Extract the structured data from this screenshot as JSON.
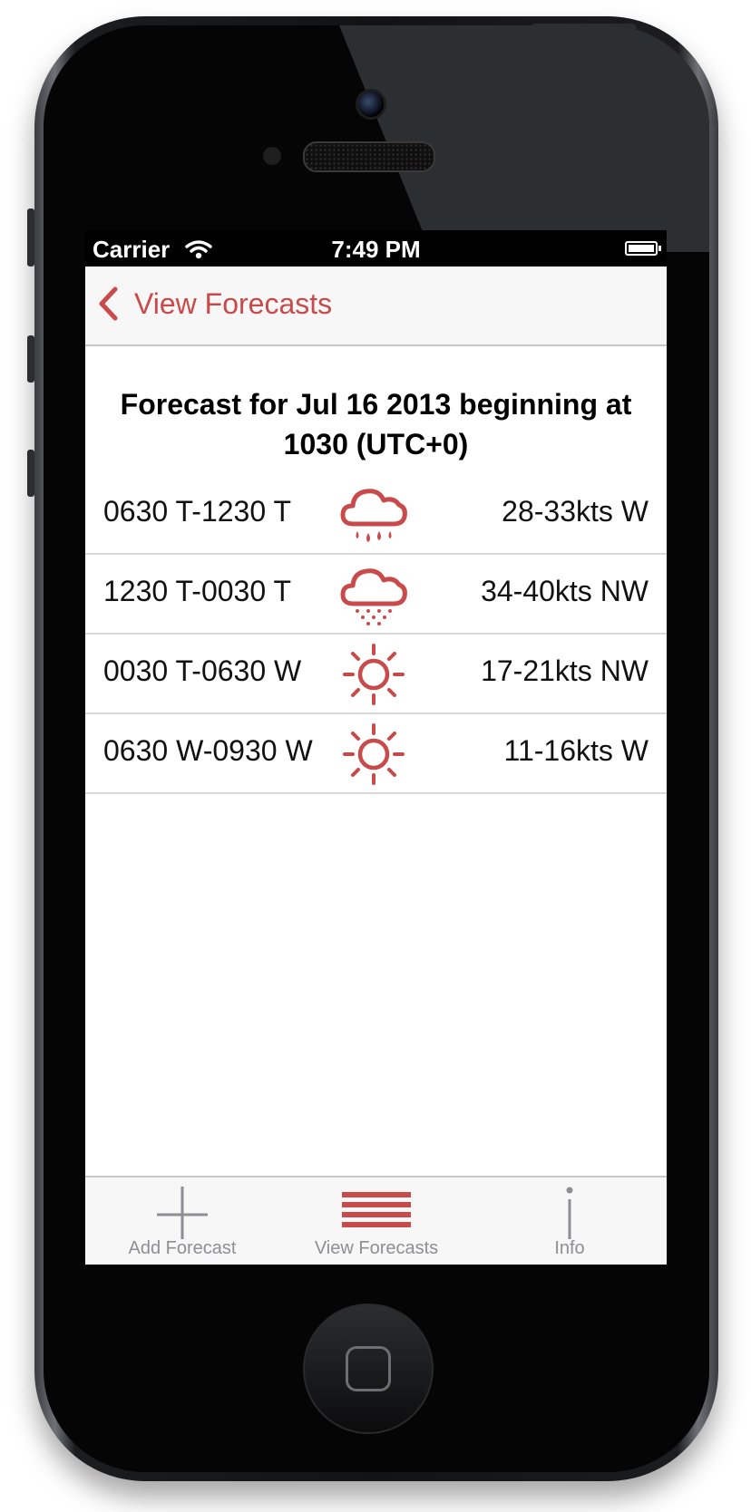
{
  "status_bar": {
    "carrier": "Carrier",
    "time": "7:49 PM"
  },
  "nav": {
    "back_label": "View Forecasts"
  },
  "heading": "Forecast for Jul 16 2013 beginning at 1030 (UTC+0)",
  "forecasts": [
    {
      "period": "0630 T-1230 T",
      "icon": "rain-cloud-icon",
      "wind": "28-33kts W"
    },
    {
      "period": "1230 T-0030 T",
      "icon": "snow-cloud-icon",
      "wind": "34-40kts NW"
    },
    {
      "period": "0030 T-0630 W",
      "icon": "sun-icon",
      "wind": "17-21kts NW"
    },
    {
      "period": "0630 W-0930 W",
      "icon": "sun-icon",
      "wind": "11-16kts W"
    }
  ],
  "tabs": [
    {
      "label": "Add Forecast",
      "icon": "plus-icon"
    },
    {
      "label": "View Forecasts",
      "icon": "list-icon",
      "active": true
    },
    {
      "label": "Info",
      "icon": "info-icon"
    }
  ],
  "colors": {
    "accent": "#c94a4a",
    "tab_inactive": "#8e8e93"
  }
}
